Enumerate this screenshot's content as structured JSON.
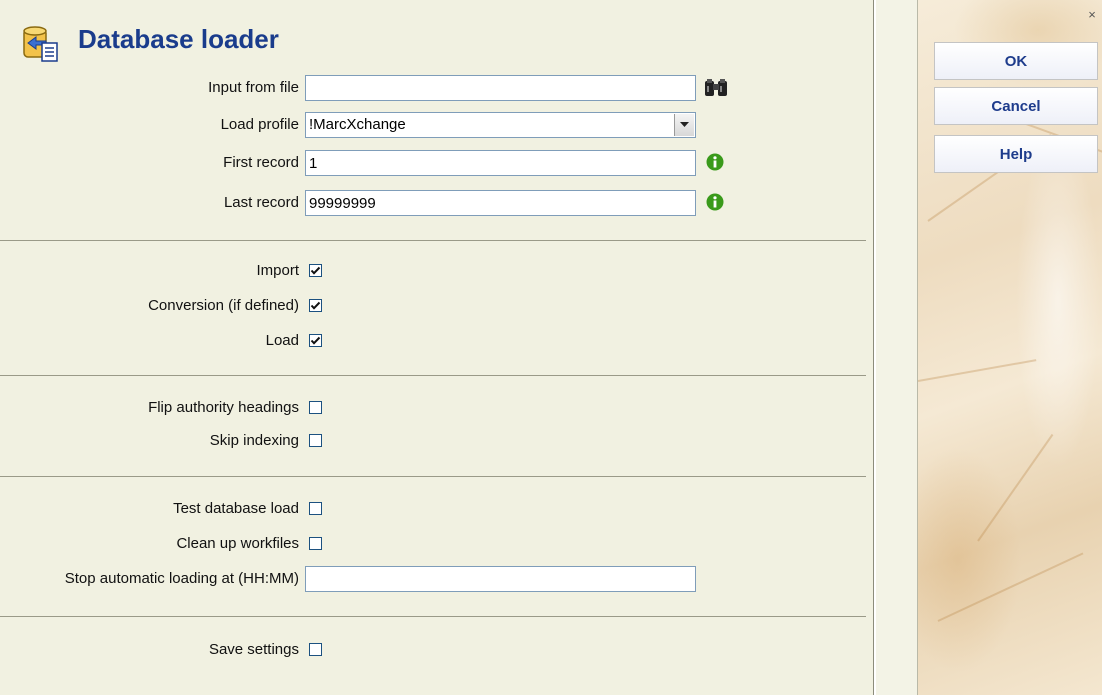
{
  "window": {
    "title": "Database loader",
    "close_label": "×"
  },
  "fields": {
    "input_file": {
      "label": "Input from file",
      "value": ""
    },
    "load_profile": {
      "label": "Load profile",
      "value": "!MarcXchange"
    },
    "first_record": {
      "label": "First record",
      "value": "1"
    },
    "last_record": {
      "label": "Last record",
      "value": "99999999"
    },
    "stop_time": {
      "label": "Stop automatic loading at (HH:MM)",
      "value": ""
    }
  },
  "checkboxes": {
    "import": {
      "label": "Import",
      "checked": true
    },
    "conversion": {
      "label": "Conversion (if defined)",
      "checked": true
    },
    "load": {
      "label": "Load",
      "checked": true
    },
    "flip_authority": {
      "label": "Flip authority headings",
      "checked": false
    },
    "skip_indexing": {
      "label": "Skip indexing",
      "checked": false
    },
    "test_load": {
      "label": "Test database load",
      "checked": false
    },
    "clean_up": {
      "label": "Clean up workfiles",
      "checked": false
    },
    "save_settings": {
      "label": "Save settings",
      "checked": false
    }
  },
  "actions": {
    "ok": "OK",
    "cancel": "Cancel",
    "help": "Help"
  },
  "icons": {
    "title": "database-loader-icon",
    "browse": "binoculars-icon",
    "info": "info-icon",
    "dropdown": "chevron-down-icon",
    "close": "close-icon"
  },
  "colors": {
    "panel_bg": "#f1f1e1",
    "title": "#1a3c8c",
    "button_text": "#1e3c8c",
    "info_green": "#3a9a1a"
  }
}
